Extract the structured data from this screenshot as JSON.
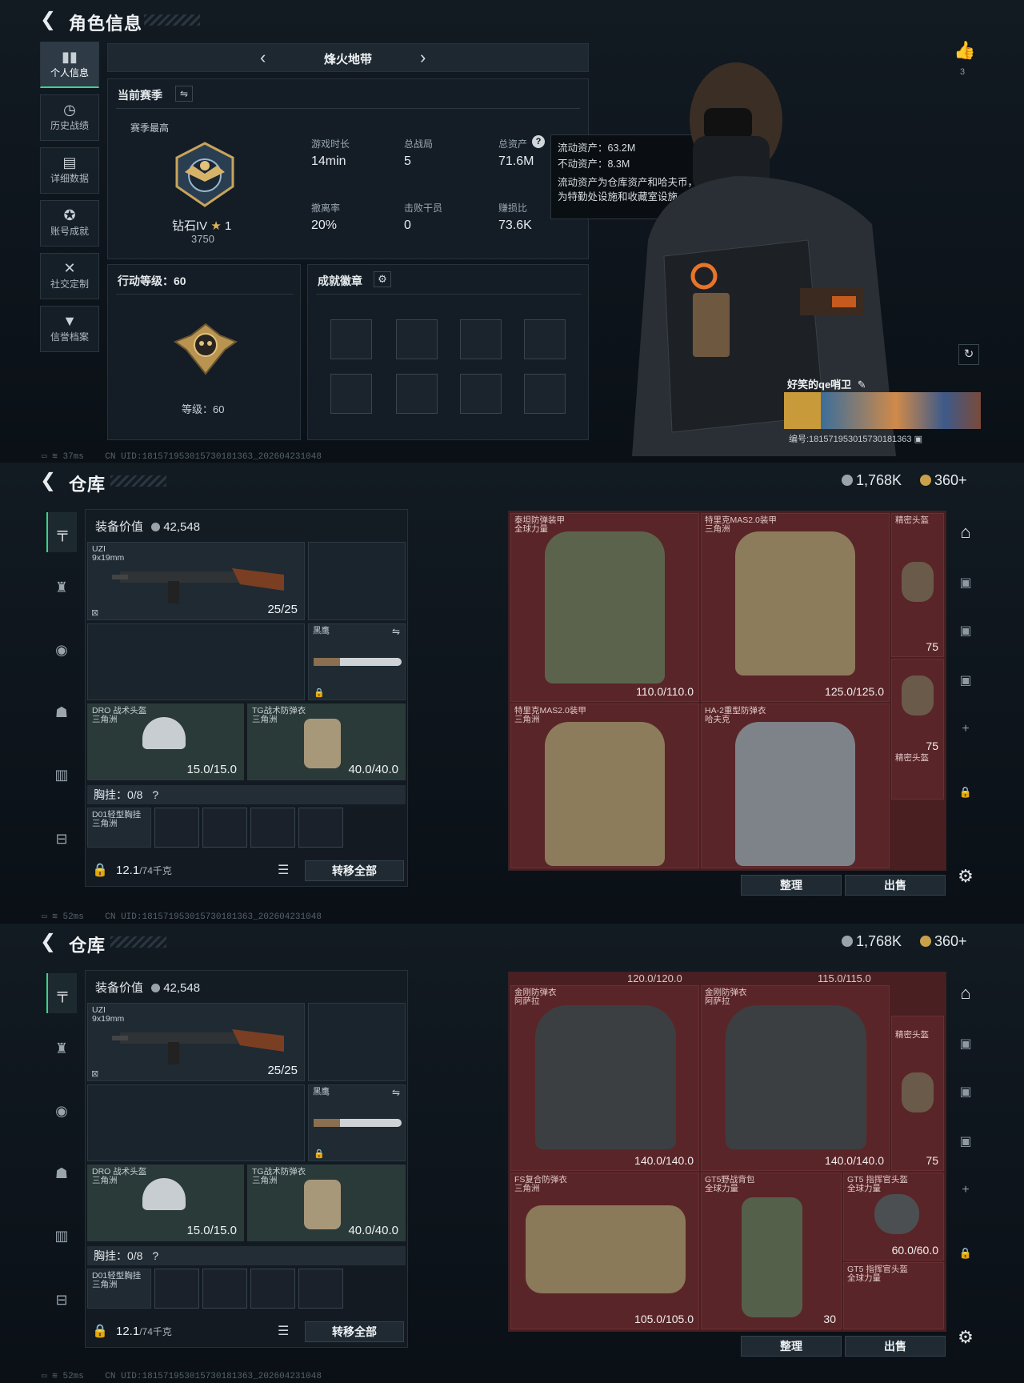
{
  "profile": {
    "title": "角色信息",
    "sidebar": [
      {
        "label": "个人信息",
        "icon": "bar-chart-icon"
      },
      {
        "label": "历史战绩",
        "icon": "clock-icon"
      },
      {
        "label": "详细数据",
        "icon": "folder-icon"
      },
      {
        "label": "账号成就",
        "icon": "medal-icon"
      },
      {
        "label": "社交定制",
        "icon": "tools-icon"
      },
      {
        "label": "信誉档案",
        "icon": "shield-icon"
      }
    ],
    "mode": "烽火地带",
    "season_label": "当前赛季",
    "season_best_label": "赛季最高",
    "rank_name": "钻石IV",
    "rank_stars": "1",
    "rank_points": "3750",
    "stats": [
      {
        "label": "游戏时长",
        "value": "14min"
      },
      {
        "label": "总战局",
        "value": "5"
      },
      {
        "label": "总资产",
        "value": "71.6M"
      },
      {
        "label": "撤离率",
        "value": "20%"
      },
      {
        "label": "击败干员",
        "value": "0"
      },
      {
        "label": "赚损比",
        "value": "73.6K"
      }
    ],
    "tooltip": {
      "liquid": "流动资产：63.2M",
      "fixed": "不动资产：8.3M",
      "desc": "流动资产为仓库资产和哈夫币，不动资产为特勤处设施和收藏室设施"
    },
    "action_level_title": "行动等级：60",
    "action_level_text": "等级：60",
    "badge_title": "成就徽章",
    "like_count": "3",
    "player_name": "好笑的qe哨卫",
    "player_id": "编号:181571953015730181363",
    "status_ping": "37ms",
    "status_uid": "CN UID:181571953015730181363_202604231048"
  },
  "warehouse_a": {
    "title": "仓库",
    "currency1": "1,768K",
    "currency2": "360+",
    "equip_value_label": "装备价值",
    "equip_value": "42,548",
    "uzi_name": "UZI",
    "uzi_sub": "9x19mm",
    "uzi_ammo": "25/25",
    "knife_name": "黑鹰",
    "helmet_name": "DRO 战术头盔",
    "helmet_sub": "三角洲",
    "helmet_val": "15.0/15.0",
    "vest_name": "TG战术防弹衣",
    "vest_sub": "三角洲",
    "vest_val": "40.0/40.0",
    "chest_label": "胸挂：0/8",
    "chest_item": "D01轻型胸挂",
    "chest_item_sub": "三角洲",
    "weight": "12.1",
    "weight_max": "/74千克",
    "transfer_all": "转移全部",
    "items": [
      {
        "name": "泰坦防弹装甲",
        "sub": "全球力量",
        "val": "110.0/110.0"
      },
      {
        "name": "特里克MAS2.0装甲",
        "sub": "三角洲",
        "val": "125.0/125.0"
      },
      {
        "name": "精密头盔",
        "sub": "",
        "val": "75"
      },
      {
        "name": "特里克MAS2.0装甲",
        "sub": "三角洲",
        "val": ""
      },
      {
        "name": "HA-2重型防弹衣",
        "sub": "哈夫克",
        "val": ""
      },
      {
        "name": "精密头盔",
        "sub": "",
        "val": "75"
      }
    ],
    "sort_btn": "整理",
    "sell_btn": "出售",
    "status_ping": "52ms",
    "status_uid": "CN UID:181571953015730181363_202604231048"
  },
  "warehouse_b": {
    "title": "仓库",
    "currency1": "1,768K",
    "currency2": "360+",
    "equip_value_label": "装备价值",
    "equip_value": "42,548",
    "uzi_name": "UZI",
    "uzi_sub": "9x19mm",
    "uzi_ammo": "25/25",
    "knife_name": "黑鹰",
    "helmet_name": "DRO 战术头盔",
    "helmet_sub": "三角洲",
    "helmet_val": "15.0/15.0",
    "vest_name": "TG战术防弹衣",
    "vest_sub": "三角洲",
    "vest_val": "40.0/40.0",
    "chest_label": "胸挂：0/8",
    "chest_item": "D01轻型胸挂",
    "chest_item_sub": "三角洲",
    "weight": "12.1",
    "weight_max": "/74千克",
    "transfer_all": "转移全部",
    "top_vals": [
      "120.0/120.0",
      "115.0/115.0"
    ],
    "items": [
      {
        "name": "金刚防弹衣",
        "sub": "阿萨拉",
        "val": "140.0/140.0"
      },
      {
        "name": "金刚防弹衣",
        "sub": "阿萨拉",
        "val": "140.0/140.0"
      },
      {
        "name": "精密头盔",
        "sub": "",
        "val": "75"
      },
      {
        "name": "FS复合防弹衣",
        "sub": "三角洲",
        "val": "105.0/105.0"
      },
      {
        "name": "GT5野战背包",
        "sub": "全球力量",
        "val": "30"
      },
      {
        "name": "GT5 指挥官头盔",
        "sub": "全球力量",
        "val": "60.0/60.0"
      },
      {
        "name": "GT5 指挥官头盔",
        "sub": "全球力量",
        "val": ""
      }
    ],
    "sort_btn": "整理",
    "sell_btn": "出售",
    "status_ping": "52ms",
    "status_uid": "CN UID:181571953015730181363_202604231048"
  }
}
